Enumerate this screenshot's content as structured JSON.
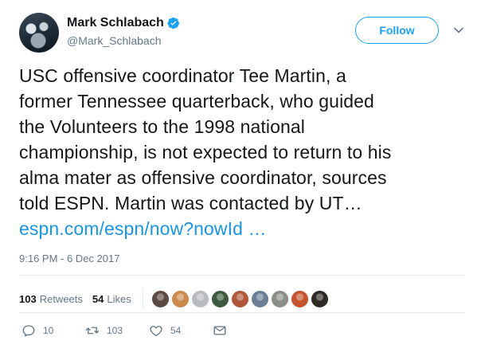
{
  "author": {
    "display_name": "Mark Schlabach",
    "handle": "@Mark_Schlabach",
    "verified": true
  },
  "follow_label": "Follow",
  "tweet": {
    "lines": [
      "USC offensive coordinator Tee Martin, a",
      "former Tennessee quarterback, who guided",
      "the Volunteers to the 1998 national",
      "championship, is not expected to return to his",
      "alma mater as offensive coordinator, sources",
      "told ESPN. Martin was contacted by UT…"
    ],
    "link_text": "espn.com/espn/now?nowId",
    "link_ellipsis": "…"
  },
  "timestamp": "9:16 PM - 6 Dec 2017",
  "stats": {
    "retweets_count": "103",
    "retweets_label": "Retweets",
    "likes_count": "54",
    "likes_label": "Likes"
  },
  "likers": [
    {
      "name": "liker-1",
      "color": "#5a4a42"
    },
    {
      "name": "liker-2",
      "color": "#c98a4b"
    },
    {
      "name": "liker-3",
      "color": "#b8bcc0"
    },
    {
      "name": "liker-4",
      "color": "#3d5a3f"
    },
    {
      "name": "liker-5",
      "color": "#b0563a"
    },
    {
      "name": "liker-6",
      "color": "#6b7f94"
    },
    {
      "name": "liker-7",
      "color": "#8a8f87"
    },
    {
      "name": "liker-8",
      "color": "#c4532e"
    },
    {
      "name": "liker-9",
      "color": "#2e2a26"
    }
  ],
  "actions": {
    "reply_count": "10",
    "retweet_count": "103",
    "like_count": "54"
  },
  "colors": {
    "accent": "#1da1f2",
    "link": "#1b95e0",
    "secondary_text": "#657786",
    "divider": "#e6ecf0"
  }
}
